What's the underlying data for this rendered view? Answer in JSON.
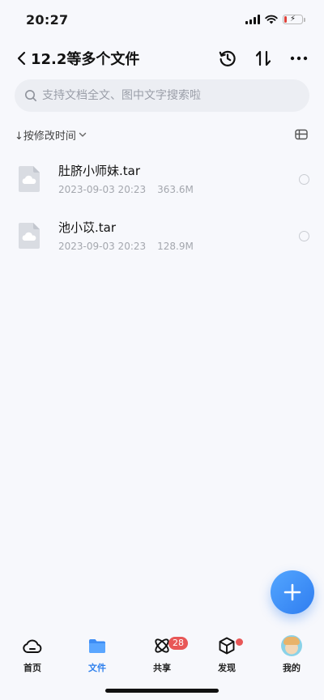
{
  "status_bar": {
    "time": "20:27",
    "battery_level": 0.15,
    "battery_color": "#e0413a"
  },
  "header": {
    "title": "12.2等多个文件",
    "back_icon": "chevron-left-icon",
    "actions": [
      "history-icon",
      "sort-arrows-icon",
      "more-icon"
    ]
  },
  "search": {
    "placeholder": "支持文档全文、图中文字搜索啦",
    "value": ""
  },
  "sortbar": {
    "sort_label": "↓按修改时间",
    "view_icon": "view-toggle-icon"
  },
  "files": [
    {
      "name": "肚脐小师妹.tar",
      "date": "2023-09-03 20:23",
      "size": "363.6M",
      "icon": "cloud-file-icon"
    },
    {
      "name": "池小苡.tar",
      "date": "2023-09-03 20:23",
      "size": "128.9M",
      "icon": "cloud-file-icon"
    }
  ],
  "tabbar": {
    "tabs": [
      {
        "label": "首页",
        "icon": "cloud-home-icon"
      },
      {
        "label": "文件",
        "icon": "folder-icon",
        "active": true
      },
      {
        "label": "共享",
        "icon": "share-atom-icon",
        "badge": "28"
      },
      {
        "label": "发现",
        "icon": "cube-icon",
        "dot": true
      },
      {
        "label": "我的",
        "icon": "avatar-icon"
      }
    ]
  },
  "colors": {
    "accent": "#2f80ed",
    "badge": "#e85757"
  }
}
